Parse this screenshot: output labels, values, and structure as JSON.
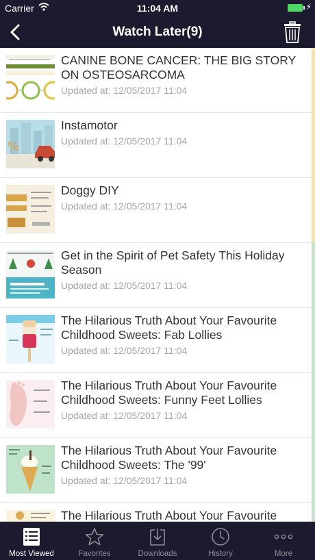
{
  "status": {
    "carrier": "Carrier",
    "time": "11:04 AM"
  },
  "nav": {
    "title": "Watch Later(9)"
  },
  "items": [
    {
      "title": "CANINE BONE CANCER: THE BIG STORY ON OSTEOSARCOMA",
      "date": "Updated at: 12/05/2017 11:04"
    },
    {
      "title": "Instamotor",
      "date": "Updated at: 12/05/2017 11:04"
    },
    {
      "title": "Doggy DIY",
      "date": "Updated at: 12/05/2017 11:04"
    },
    {
      "title": "Get in the Spirit of Pet Safety This Holiday Season",
      "date": "Updated at: 12/05/2017 11:04"
    },
    {
      "title": "The Hilarious Truth About Your Favourite Childhood Sweets: Fab Lollies",
      "date": "Updated at: 12/05/2017 11:04"
    },
    {
      "title": "The Hilarious Truth About Your Favourite Childhood Sweets: Funny Feet Lollies",
      "date": "Updated at: 12/05/2017 11:04"
    },
    {
      "title": "The Hilarious Truth About Your Favourite Childhood Sweets: The '99'",
      "date": "Updated at: 12/05/2017 11:04"
    },
    {
      "title": "The Hilarious Truth About Your Favourite",
      "date": ""
    }
  ],
  "tabs": [
    {
      "label": "Most Viewed",
      "icon": "list-icon",
      "active": true
    },
    {
      "label": "Favorites",
      "icon": "star-icon",
      "active": false
    },
    {
      "label": "Downloads",
      "icon": "download-icon",
      "active": false
    },
    {
      "label": "History",
      "icon": "clock-icon",
      "active": false
    },
    {
      "label": "More",
      "icon": "more-icon",
      "active": false
    }
  ],
  "colors": {
    "bar_background": "#1c1a2e",
    "active_tab": "#ffffff",
    "inactive_tab": "#8e8e93",
    "date_text": "#a6a6a6",
    "title_text": "#333333"
  }
}
